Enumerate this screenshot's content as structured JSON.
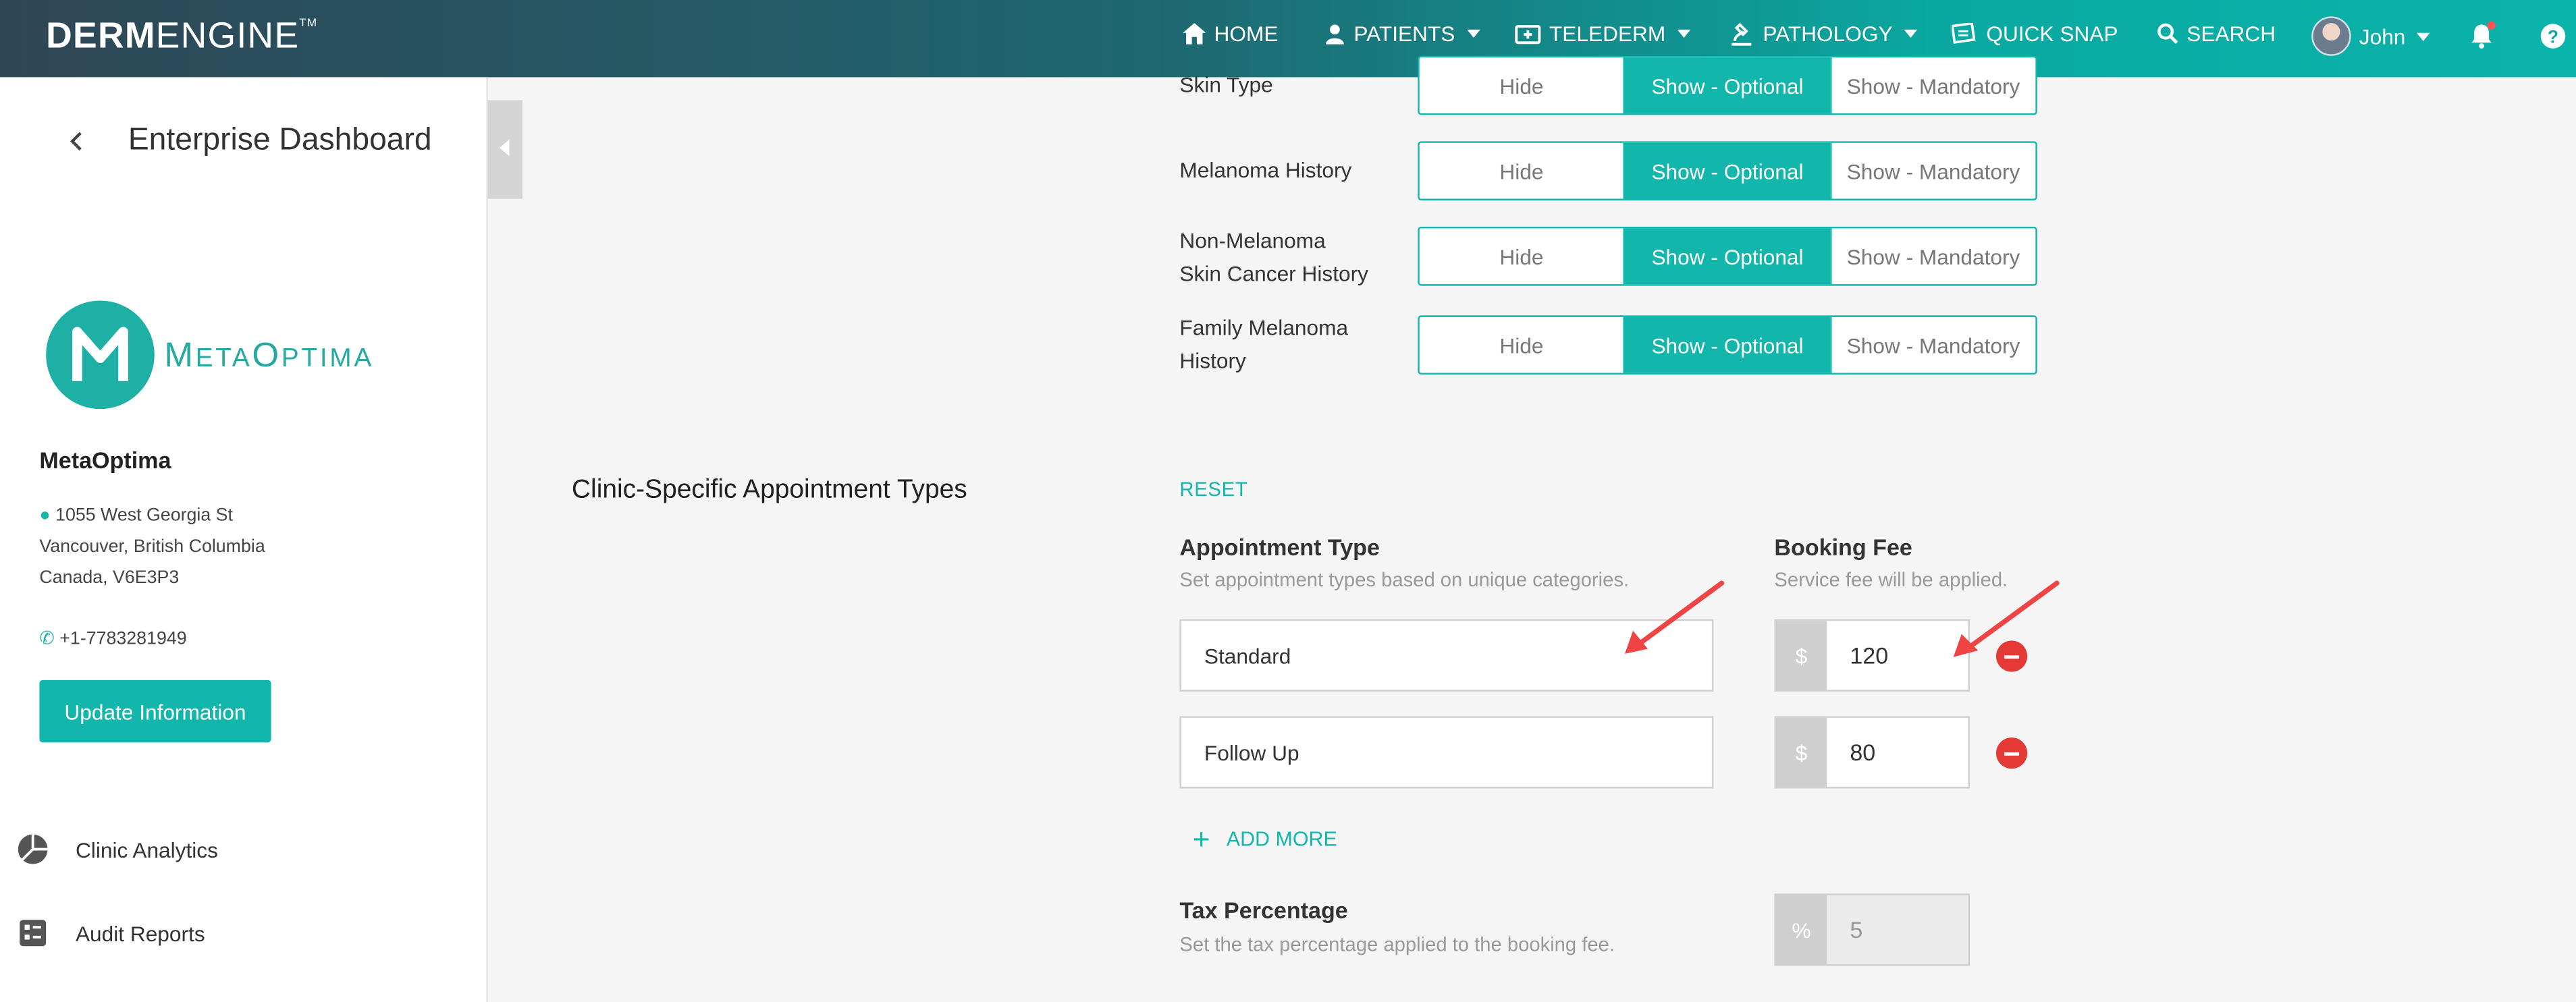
{
  "nav": {
    "brand_bold": "DERM",
    "brand_light": "ENGINE",
    "brand_tm": "TM",
    "items": {
      "home": "HOME",
      "patients": "PATIENTS",
      "telederm": "TELEDERM",
      "pathology": "PATHOLOGY",
      "quick_snap": "QUICK SNAP",
      "search": "SEARCH",
      "user": "John"
    }
  },
  "sidebar": {
    "title": "Enterprise Dashboard",
    "logo_text": "MetaOptima",
    "org_name": "MetaOptima",
    "address": [
      "1055 West Georgia St",
      "Vancouver, British Columbia",
      "Canada, V6E3P3"
    ],
    "phone": "+1-7783281949",
    "update_button": "Update Information",
    "links": [
      "Clinic Analytics",
      "Audit Reports"
    ]
  },
  "visibility_rows": [
    {
      "label_lines": [
        "Skin Type"
      ],
      "options": [
        "Hide",
        "Show - Optional",
        "Show - Mandatory"
      ],
      "selected": "Show - Optional"
    },
    {
      "label_lines": [
        "Melanoma History"
      ],
      "options": [
        "Hide",
        "Show - Optional",
        "Show - Mandatory"
      ],
      "selected": "Show - Optional"
    },
    {
      "label_lines": [
        "Non-Melanoma",
        "Skin Cancer History"
      ],
      "options": [
        "Hide",
        "Show - Optional",
        "Show - Mandatory"
      ],
      "selected": "Show - Optional"
    },
    {
      "label_lines": [
        "Family Melanoma",
        "History"
      ],
      "options": [
        "Hide",
        "Show - Optional",
        "Show - Mandatory"
      ],
      "selected": "Show - Optional"
    }
  ],
  "appointments": {
    "section_title": "Clinic-Specific Appointment Types",
    "reset_label": "RESET",
    "type_header": "Appointment Type",
    "type_sub": "Set appointment types based on unique categories.",
    "fee_header": "Booking Fee",
    "fee_sub": "Service fee will be applied.",
    "currency_symbol": "$",
    "rows": [
      {
        "type": "Standard",
        "fee": "120"
      },
      {
        "type": "Follow Up",
        "fee": "80"
      }
    ],
    "add_more_label": "ADD MORE",
    "tax_header": "Tax Percentage",
    "tax_sub": "Set the tax percentage applied to the booking fee.",
    "tax_symbol": "%",
    "tax_value": "5"
  },
  "colors": {
    "accent": "#13b6ab",
    "danger": "#e53935",
    "annotation_arrow": "#ef4444"
  },
  "icons": [
    "home-icon",
    "patients-icon",
    "telederm-icon",
    "pathology-icon",
    "quick-snap-icon",
    "search-icon",
    "bell-icon",
    "help-icon",
    "map-pin-icon",
    "phone-icon",
    "pie-chart-icon",
    "report-icon",
    "chevron-left-icon",
    "plus-icon",
    "minus-circle-icon"
  ]
}
